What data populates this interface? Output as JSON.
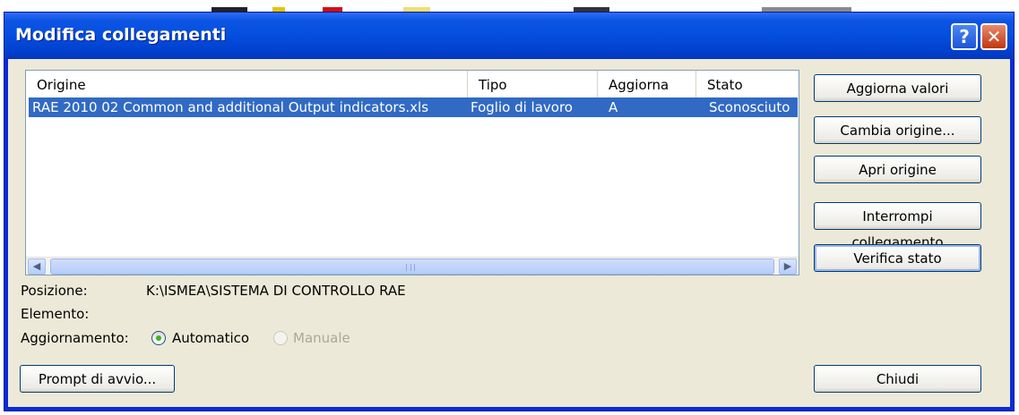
{
  "window": {
    "title": "Modifica collegamenti"
  },
  "titlebar_buttons": {
    "help": "?",
    "close": "✕"
  },
  "list": {
    "columns": [
      "Origine",
      "Tipo",
      "Aggiorna",
      "Stato"
    ],
    "rows": [
      {
        "origine": "RAE 2010 02 Common and additional Output indicators.xls",
        "tipo": "Foglio di lavoro",
        "aggiorna": "A",
        "stato": "Sconosciuto"
      }
    ],
    "scroll_left": "◀",
    "scroll_right": "▶"
  },
  "buttons": {
    "aggiorna_valori": "Aggiorna valori",
    "cambia_origine": "Cambia origine...",
    "apri_origine": "Apri origine",
    "interrompi": "Interrompi collegamento",
    "verifica_stato": "Verifica stato",
    "prompt_avvio": "Prompt di avvio...",
    "chiudi": "Chiudi"
  },
  "details": {
    "posizione_label": "Posizione:",
    "posizione_value": "K:\\ISMEA\\SISTEMA DI CONTROLLO RAE",
    "elemento_label": "Elemento:",
    "elemento_value": "",
    "aggiornamento_label": "Aggiornamento:",
    "automatico_label": "Automatico",
    "manuale_label": "Manuale",
    "selected": "Automatico"
  },
  "colors": {
    "titlebar": "#0550e0",
    "selection": "#316ac5",
    "dialog": "#ece9d8"
  }
}
